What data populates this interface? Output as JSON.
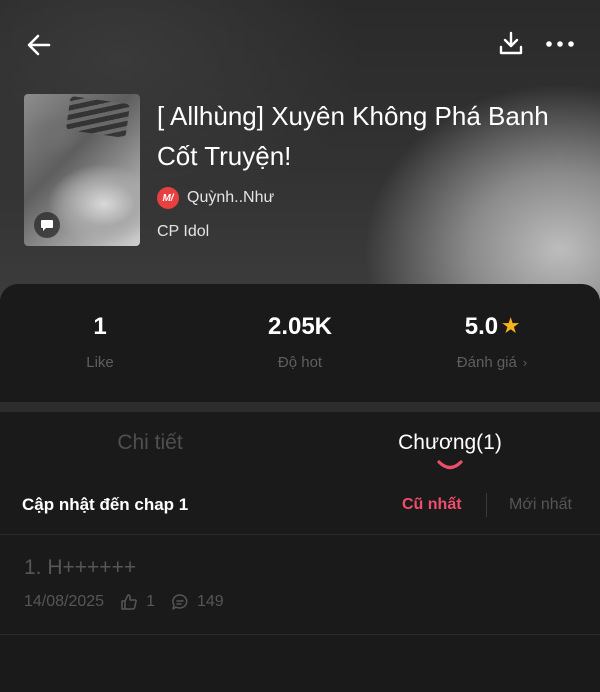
{
  "topbar": {
    "back_icon": "arrow-left-icon",
    "download_icon": "download-icon",
    "more_icon": "more-horizontal-icon"
  },
  "story": {
    "title": "[ Allhùng] Xuyên Không Phá Banh Cốt Truyện!",
    "author_logo": "M/",
    "author": "Quỳnh..Như",
    "category": "CP Idol"
  },
  "stats": {
    "likes": {
      "value": "1",
      "label": "Like"
    },
    "hot": {
      "value": "2.05K",
      "label": "Độ hot"
    },
    "rating": {
      "value": "5.0",
      "label": "Đánh giá"
    }
  },
  "tabs": {
    "details": "Chi tiết",
    "chapters": "Chương(1)"
  },
  "chapter_list": {
    "update_text": "Cập nhật đến chap 1",
    "sort_oldest": "Cũ nhất",
    "sort_newest": "Mới nhất",
    "items": [
      {
        "title": "1. H++++++",
        "date": "14/08/2025",
        "likes": "1",
        "comments": "149"
      }
    ]
  },
  "colors": {
    "accent": "#ef4d6c",
    "star": "#f5b41b",
    "background": "#1a1a1a"
  }
}
